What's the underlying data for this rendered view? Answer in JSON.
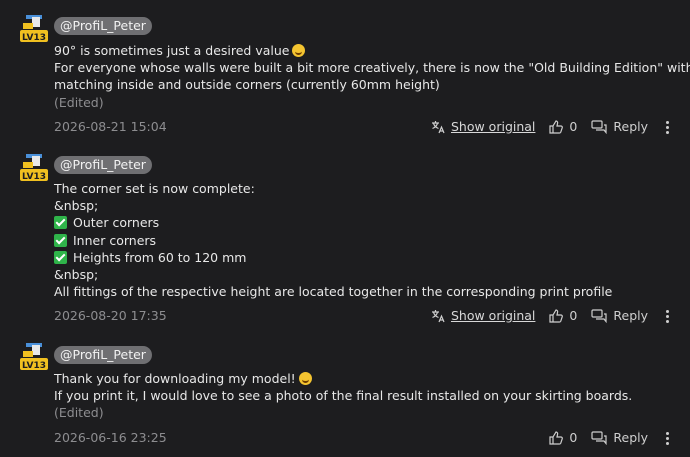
{
  "comments": [
    {
      "username": "@ProfiL_Peter",
      "avatar_badge": "LV13",
      "lines": [
        "90° is sometimes just a desired value",
        "For everyone whose walls were built a bit more creatively, there is now the \"Old Building Edition\" with",
        "matching inside and outside corners (currently 60mm height)"
      ],
      "edited": "(Edited)",
      "date": "2026-08-21 15:04",
      "show_original": "Show original",
      "likes": "0",
      "reply": "Reply"
    },
    {
      "username": "@ProfiL_Peter",
      "avatar_badge": "LV13",
      "lines": [
        "The corner set is now complete:",
        "&nbsp;",
        "Outer corners",
        "Inner corners",
        "Heights from 60 to 120 mm",
        "&nbsp;",
        "All fittings of the respective height are located together in the corresponding print profile"
      ],
      "date": "2026-08-20 17:35",
      "show_original": "Show original",
      "likes": "0",
      "reply": "Reply"
    },
    {
      "username": "@ProfiL_Peter",
      "avatar_badge": "LV13",
      "lines": [
        "Thank you for downloading my model!",
        "If you print it, I would love to see a photo of the final result installed on your skirting boards."
      ],
      "edited": "(Edited)",
      "date": "2026-06-16 23:25",
      "likes": "0",
      "reply": "Reply"
    }
  ],
  "colors": {
    "background": "#1d1d1f",
    "username_pill": "#6f6f72",
    "checkmark": "#2fb44a",
    "muted_text": "#8d8d90"
  },
  "icons": [
    "avatar-logo-icon",
    "translate-icon",
    "thumbs-up-icon",
    "reply-icon",
    "more-icon",
    "smile-emoji-icon",
    "check-emoji-icon"
  ]
}
